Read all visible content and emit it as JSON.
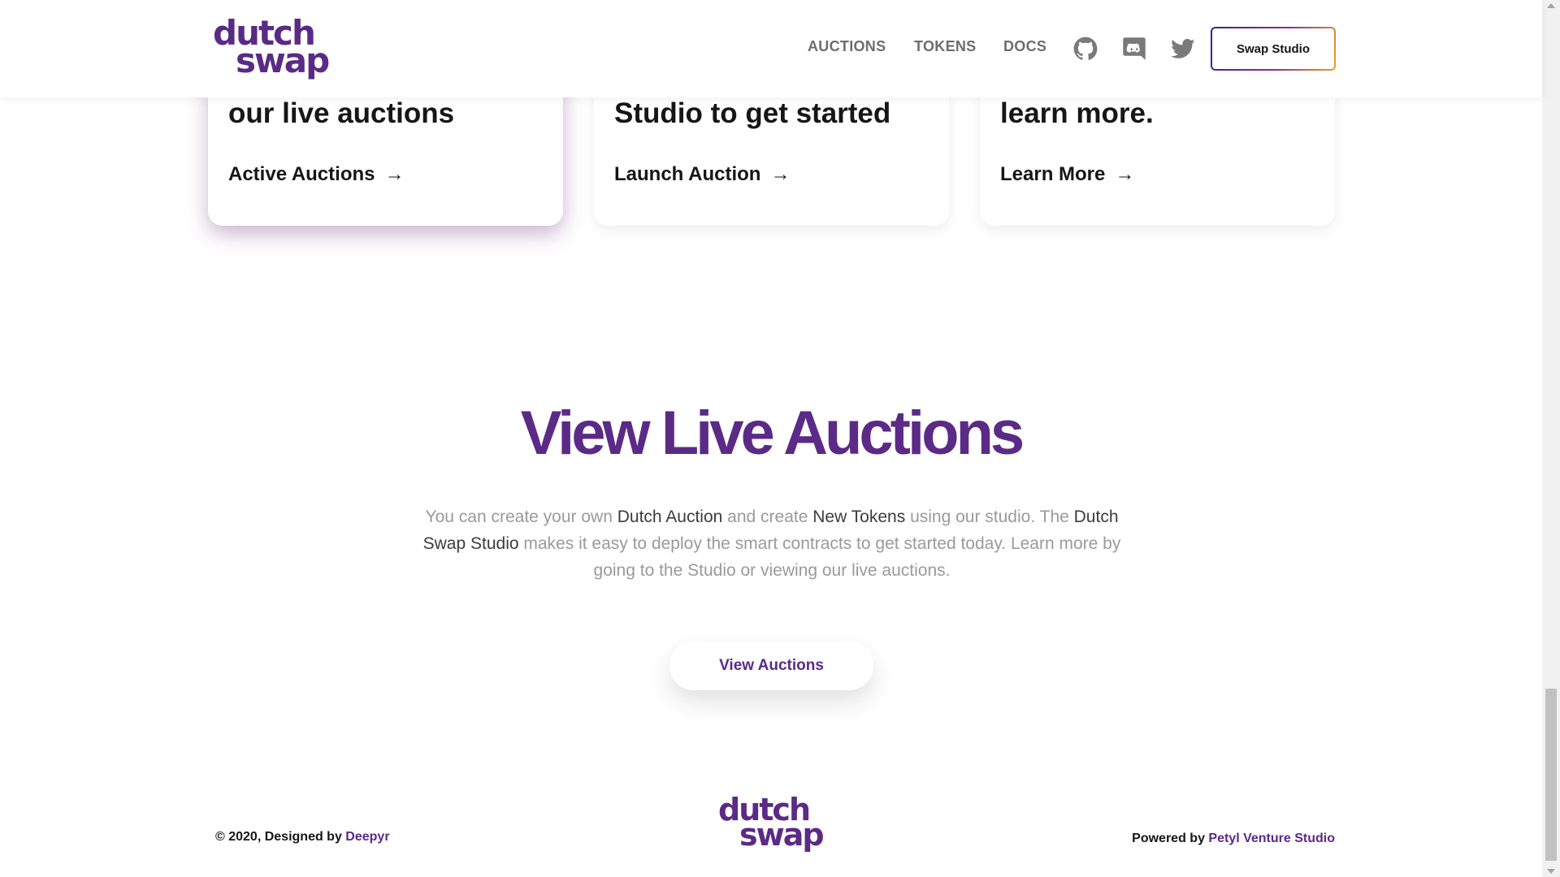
{
  "header": {
    "logo": {
      "line1": "dutch",
      "line2": "swap"
    },
    "nav": [
      {
        "label": "AUCTIONS"
      },
      {
        "label": "TOKENS"
      },
      {
        "label": "DOCS"
      }
    ],
    "social_icons": [
      "github-icon",
      "discord-icon",
      "twitter-icon"
    ],
    "cta_label": "Swap Studio"
  },
  "cards": [
    {
      "heading": "our live auctions",
      "link_label": "Active Auctions",
      "arrow": "→",
      "active": true
    },
    {
      "heading": "Studio to get started",
      "link_label": "Launch Auction",
      "arrow": "→",
      "active": false
    },
    {
      "heading": "learn more.",
      "link_label": "Learn More",
      "arrow": "→",
      "active": false
    }
  ],
  "section": {
    "title": "View Live Auctions",
    "paragraph": {
      "t1": "You can create your own ",
      "h1": "Dutch Auction",
      "t2": " and create ",
      "h2": "New Tokens",
      "t3": " using our studio. The ",
      "h3": "Dutch Swap Studio",
      "t4": " makes it easy to deploy the smart contracts to get started today. Learn more by going to the Studio or viewing our live auctions."
    },
    "button_label": "View Auctions"
  },
  "footer": {
    "copyright_prefix": "© 2020, Designed by ",
    "designer": "Deepyr",
    "logo": {
      "line1": "dutch",
      "line2": "swap"
    },
    "powered_prefix": "Powered by ",
    "powered_by": "Petyl Venture Studio"
  },
  "colors": {
    "brand_purple": "#5b2a86",
    "text_dark": "#161616",
    "text_muted": "#9a9a9a",
    "nav_gray": "#6d6d6d",
    "gradient_start": "#3c1f9c",
    "gradient_end": "#f0a020"
  }
}
